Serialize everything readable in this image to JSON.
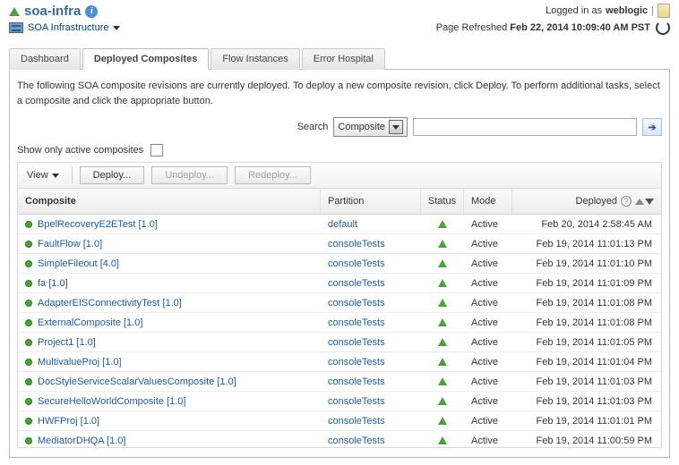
{
  "header": {
    "title": "soa-infra",
    "logged_in_prefix": "Logged in as ",
    "user": "weblogic",
    "infra_menu_label": "SOA Infrastructure",
    "refresh_prefix": "Page Refreshed ",
    "refresh_time": "Feb 22, 2014 10:09:40 AM PST"
  },
  "tabs": {
    "dashboard": "Dashboard",
    "deployed": "Deployed Composites",
    "flow": "Flow Instances",
    "error": "Error Hospital"
  },
  "panel": {
    "description": "The following SOA composite revisions are currently deployed. To deploy a new composite revision, click Deploy. To perform additional tasks, select a composite and click the appropriate button.",
    "search_label": "Search",
    "search_type": "Composite",
    "search_placeholder": "",
    "filter_label": "Show only active composites",
    "view_label": "View",
    "deploy_btn": "Deploy...",
    "undeploy_btn": "Undeploy...",
    "redeploy_btn": "Redeploy..."
  },
  "columns": {
    "composite": "Composite",
    "partition": "Partition",
    "status": "Status",
    "mode": "Mode",
    "deployed": "Deployed"
  },
  "rows": [
    {
      "name": "BpelRecoveryE2ETest [1.0]",
      "partition": "default",
      "mode": "Active",
      "deployed": "Feb 20, 2014 2:58:45 AM"
    },
    {
      "name": "FaultFlow [1.0]",
      "partition": "consoleTests",
      "mode": "Active",
      "deployed": "Feb 19, 2014 11:01:13 PM"
    },
    {
      "name": "SimpleFileout [4.0]",
      "partition": "consoleTests",
      "mode": "Active",
      "deployed": "Feb 19, 2014 11:01:10 PM"
    },
    {
      "name": "fa [1.0]",
      "partition": "consoleTests",
      "mode": "Active",
      "deployed": "Feb 19, 2014 11:01:09 PM"
    },
    {
      "name": "AdapterEISConnectivityTest [1.0]",
      "partition": "consoleTests",
      "mode": "Active",
      "deployed": "Feb 19, 2014 11:01:08 PM"
    },
    {
      "name": "ExternalComposite [1.0]",
      "partition": "consoleTests",
      "mode": "Active",
      "deployed": "Feb 19, 2014 11:01:08 PM"
    },
    {
      "name": "Project1 [1.0]",
      "partition": "consoleTests",
      "mode": "Active",
      "deployed": "Feb 19, 2014 11:01:05 PM"
    },
    {
      "name": "MultivalueProj [1.0]",
      "partition": "consoleTests",
      "mode": "Active",
      "deployed": "Feb 19, 2014 11:01:04 PM"
    },
    {
      "name": "DocStyleServiceScalarValuesComposite [1.0]",
      "partition": "consoleTests",
      "mode": "Active",
      "deployed": "Feb 19, 2014 11:01:03 PM"
    },
    {
      "name": "SecureHelloWorldComposite [1.0]",
      "partition": "consoleTests",
      "mode": "Active",
      "deployed": "Feb 19, 2014 11:01:03 PM"
    },
    {
      "name": "HWFProj [1.0]",
      "partition": "consoleTests",
      "mode": "Active",
      "deployed": "Feb 19, 2014 11:01:01 PM"
    },
    {
      "name": "MediatorDHQA [1.0]",
      "partition": "consoleTests",
      "mode": "Active",
      "deployed": "Feb 19, 2014 11:00:59 PM"
    }
  ]
}
